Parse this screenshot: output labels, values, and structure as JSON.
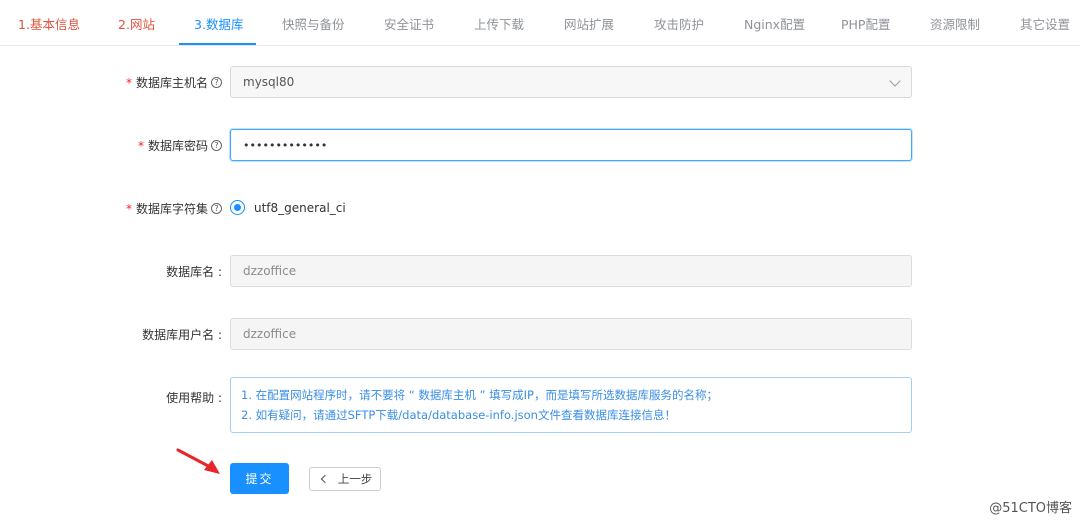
{
  "tabs": [
    {
      "num": "1.",
      "label": "基本信息"
    },
    {
      "num": "2.",
      "label": "网站"
    },
    {
      "num": "3.",
      "label": "数据库"
    },
    {
      "label": "快照与备份"
    },
    {
      "label": "安全证书"
    },
    {
      "label": "上传下载"
    },
    {
      "label": "网站扩展"
    },
    {
      "label": "攻击防护"
    },
    {
      "label": "Nginx配置"
    },
    {
      "label": "PHP配置"
    },
    {
      "label": "资源限制"
    },
    {
      "label": "其它设置"
    }
  ],
  "form": {
    "host": {
      "required": "*",
      "label": "数据库主机名",
      "value": "mysql80"
    },
    "password": {
      "required": "*",
      "label": "数据库密码",
      "value": "•••••••••••••"
    },
    "charset": {
      "required": "*",
      "label": "数据库字符集",
      "option": "utf8_general_ci"
    },
    "dbname": {
      "label": "数据库名 :",
      "value": "dzzoffice"
    },
    "dbuser": {
      "label": "数据库用户名 :",
      "value": "dzzoffice"
    },
    "help": {
      "label": "使用帮助 :",
      "line1": "1. 在配置网站程序时，请不要将 “ 数据库主机 ” 填写成IP，而是填写所选数据库服务的名称；",
      "line2": "2. 如有疑问，请通过SFTP下载/data/database-info.json文件查看数据库连接信息！"
    }
  },
  "buttons": {
    "submit": "提交",
    "back": "上一步"
  },
  "help_glyph": "?",
  "watermark": "@51CTO博客",
  "colors": {
    "accent": "#1890ff",
    "step": "#e0533f",
    "required": "#f5222d"
  }
}
